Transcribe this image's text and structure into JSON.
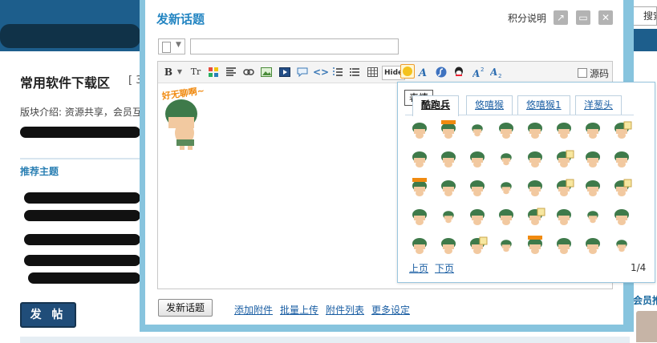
{
  "background_page": {
    "forum_title": "常用软件下载区",
    "forum_title_suffix": "[ 3",
    "forum_desc": "版块介绍: 资源共享，会员互",
    "recommended_label": "推荐主题",
    "post_button": "发 帖",
    "right_search": "搜索",
    "right_member": "会员推"
  },
  "dialog": {
    "title": "发新话题",
    "points_link": "积分说明",
    "subject_value": "",
    "source_label": "源码"
  },
  "toolbar": {
    "bold": "B",
    "font_size": "Tr",
    "hide": "Hide"
  },
  "tooltip": "表情",
  "emoticons": {
    "tabs": [
      "酷跑兵",
      "悠嘻猴",
      "悠嘻猴1",
      "洋葱头"
    ],
    "active_tab": "酷跑兵",
    "grid": {
      "rows": [
        [
          "soldier",
          "soldier-cheer",
          "soldier-small",
          "soldier",
          "soldier",
          "soldier",
          "soldier",
          "soldier-sign"
        ],
        [
          "soldier",
          "soldier",
          "soldier",
          "soldier-small",
          "soldier",
          "soldier-sign",
          "soldier",
          "soldier"
        ],
        [
          "soldier-cheer",
          "soldier",
          "soldier",
          "soldier-small",
          "soldier",
          "soldier-sign",
          "soldier",
          "soldier-sign"
        ],
        [
          "soldier",
          "soldier-small",
          "soldier",
          "soldier",
          "soldier-sign",
          "soldier",
          "soldier-small",
          "soldier"
        ],
        [
          "soldier",
          "soldier",
          "soldier-sign",
          "soldier-small",
          "soldier-cheer",
          "soldier",
          "soldier",
          "soldier-small"
        ]
      ]
    },
    "prev_label": "上页",
    "next_label": "下页",
    "page": "1/4"
  },
  "inserted_emoticon_text": "好无聊啊~",
  "footer": {
    "submit": "发新话题",
    "links": [
      "添加附件",
      "批量上传",
      "附件列表",
      "更多设定"
    ]
  },
  "colors": {
    "accent": "#2385c2",
    "modal_frame": "#87c4de",
    "link": "#1a5ea3",
    "soldier_helmet": "#3e7a4a",
    "soldier_skin": "#f2c9a0"
  }
}
